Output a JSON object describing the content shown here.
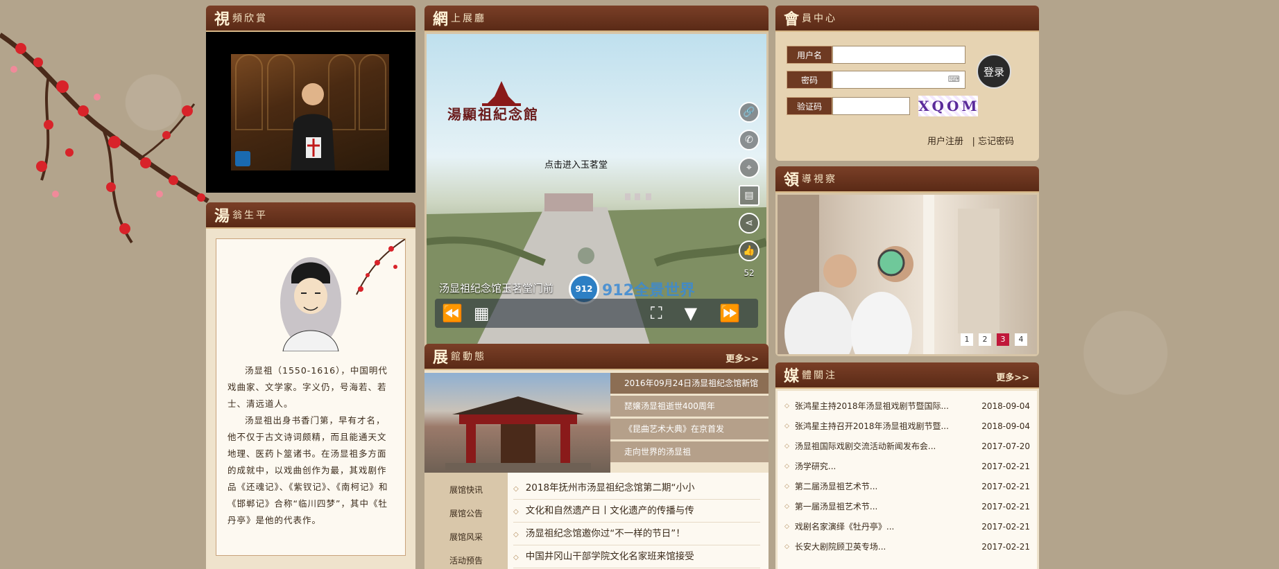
{
  "colors": {
    "brand": "#6e3a22",
    "accent": "#c0183a",
    "paper": "#efe3cc",
    "background": "#b3a48c"
  },
  "video": {
    "title_big": "視",
    "title_rest": "頻欣賞"
  },
  "bio": {
    "title_big": "湯",
    "title_rest": "翁生平",
    "paragraphs": [
      "汤显祖（1550-1616），中国明代戏曲家、文学家。字义仍，号海若、若士、清远道人。",
      "汤显祖出身书香门第，早有才名，他不仅于古文诗词颇精，而且能通天文地理、医药卜筮诸书。在汤显祖多方面的成就中，以戏曲创作为最，其戏剧作品《还魂记》、《紫钗记》、《南柯记》和《邯郸记》合称“临川四梦”，其中《牡丹亭》是他的代表作。"
    ]
  },
  "hall": {
    "title_big": "網",
    "title_rest": "上展廳",
    "logo_text": "湯顯祖紀念館",
    "enter_label": "点击进入玉茗堂",
    "caption": "汤显祖纪念馆玉茗堂门前",
    "watermark_badge": "912",
    "watermark_text": "912全景世界",
    "like_count": "52",
    "icons": [
      "link-icon",
      "phone-icon",
      "location-icon",
      "card-icon",
      "share-icon",
      "thumb-up-icon"
    ]
  },
  "news": {
    "title_big": "展",
    "title_rest": "館動態",
    "more": "更多>>",
    "side_items": [
      "2016年09月24日汤显祖纪念馆新馆",
      "琵嬢汤显祖逝世400周年",
      "《昆曲艺术大典》在京首发",
      "走向世界的汤显祖"
    ],
    "tabs": [
      "展馆快讯",
      "展馆公告",
      "展馆风采",
      "活动预告"
    ],
    "list": [
      "2018年抚州市汤显祖纪念馆第二期“小小",
      "文化和自然遗产日丨文化遗产的传播与传",
      "汤显祖纪念馆邀你过“不一样的节日”！",
      "中国井冈山干部学院文化名家班来馆接受"
    ]
  },
  "member": {
    "title_big": "會",
    "title_rest": "員中心",
    "username_label": "用户名",
    "password_label": "密码",
    "captcha_label": "验证码",
    "captcha_text": "XQOM",
    "login_label": "登录",
    "register_label": "用户注册",
    "separator": "|",
    "forgot_label": "忘记密码",
    "keyboard_glyph": "⌨"
  },
  "leader": {
    "title_big": "領",
    "title_rest": "導視察",
    "pages": [
      "1",
      "2",
      "3",
      "4"
    ],
    "active_page_index": 2
  },
  "media": {
    "title_big": "媒",
    "title_rest": "體關注",
    "more": "更多>>",
    "items": [
      {
        "title": "张鸿星主持2018年汤显祖戏剧节暨国际...",
        "date": "2018-09-04"
      },
      {
        "title": "张鸿星主持召开2018年汤显祖戏剧节暨...",
        "date": "2018-09-04"
      },
      {
        "title": "汤显祖国际戏剧交流活动新闻发布会...",
        "date": "2017-07-20"
      },
      {
        "title": "汤学研究...",
        "date": "2017-02-21"
      },
      {
        "title": "第二届汤显祖艺术节...",
        "date": "2017-02-21"
      },
      {
        "title": "第一届汤显祖艺术节...",
        "date": "2017-02-21"
      },
      {
        "title": "戏剧名家演绎《牡丹亭》...",
        "date": "2017-02-21"
      },
      {
        "title": "长安大剧院顾卫英专场...",
        "date": "2017-02-21"
      }
    ]
  }
}
